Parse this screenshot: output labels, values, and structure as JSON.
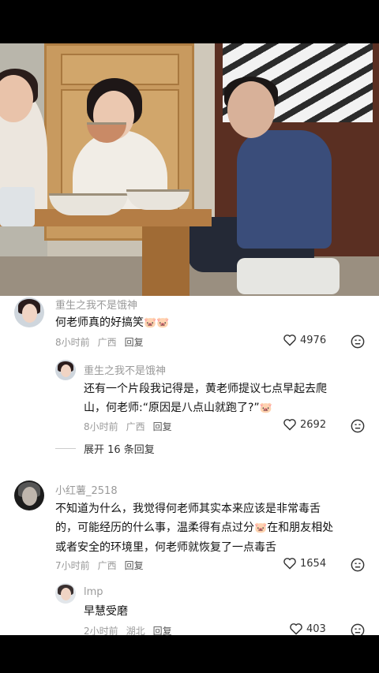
{
  "comments": [
    {
      "username": "重生之我不是饿神",
      "text": "何老师真的好搞笑",
      "emoji": "🐷🐷",
      "time": "8小时前",
      "location": "广西",
      "reply_label": "回复",
      "likes": "4976"
    },
    {
      "username": "重生之我不是饿神",
      "text_line1": "还有一个片段我记得是，黄老师提议七点早起去爬",
      "text_line2": "山，何老师:“原因是八点山就跑了?”",
      "emoji": "🐷",
      "time": "8小时前",
      "location": "广西",
      "reply_label": "回复",
      "likes": "2692"
    },
    {
      "expand_label": "展开 16 条回复"
    },
    {
      "username": "小红薯_2518",
      "text_line1": "不知道为什么，我觉得何老师其实本来应该是非常毒舌",
      "text_line2a": "的，可能经历的什么事，温柔得有点过分",
      "text_line2b": "在和朋友相处",
      "text_line3": "或者安全的环境里，何老师就恢复了一点毒舌",
      "emoji": "🐷",
      "time": "7小时前",
      "location": "广西",
      "reply_label": "回复",
      "likes": "1654"
    },
    {
      "username": "lmp",
      "text": "早慧受磨",
      "time": "2小时前",
      "location": "湖北",
      "reply_label": "回复",
      "likes": "403"
    }
  ],
  "icons": {
    "like": "heart-outline-icon",
    "dismiss": "dismiss-face-icon"
  },
  "colors": {
    "username": "#9a9a9a",
    "text": "#111111",
    "meta": "#999999"
  }
}
